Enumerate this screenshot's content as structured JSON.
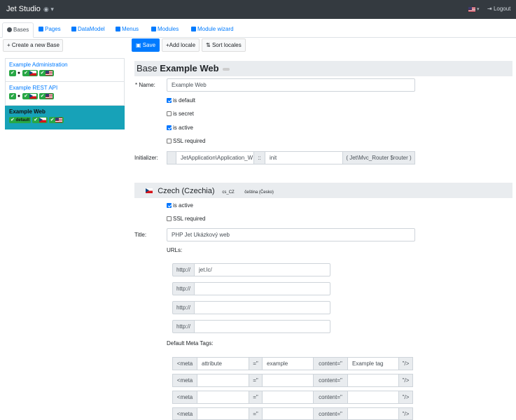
{
  "app": {
    "title": "Jet Studio",
    "logout_label": "Logout"
  },
  "tabs": [
    {
      "label": "Bases"
    },
    {
      "label": "Pages"
    },
    {
      "label": "DataModel"
    },
    {
      "label": "Menus"
    },
    {
      "label": "Modules"
    },
    {
      "label": "Module wizard"
    }
  ],
  "sidebar": {
    "create_label": "Create a new Base",
    "bases": [
      {
        "name": "Example Administration"
      },
      {
        "name": "Example REST API"
      },
      {
        "name": "Example Web",
        "default_label": "default"
      }
    ]
  },
  "toolbar": {
    "save_label": "Save",
    "add_locale_label": "Add locale",
    "sort_locales_label": "Sort locales"
  },
  "base": {
    "heading_prefix": "Base",
    "heading_name": "Example Web",
    "name_label": "* Name:",
    "name_value": "Example Web",
    "is_default_label": "is default",
    "is_secret_label": "is secret",
    "is_active_label": "is active",
    "ssl_label": "SSL required",
    "initializer_label": "Initializer:",
    "initializer_class": "JetApplication\\Application_W",
    "initializer_sep": "::",
    "initializer_method": "init",
    "initializer_signature": "( Jet\\Mvc_Router $router )"
  },
  "locale": {
    "title": "Czech (Czechia)",
    "code": "cs_CZ",
    "native": "čeština (Česko)",
    "is_active_label": "is active",
    "ssl_label": "SSL required",
    "title_label": "Title:",
    "title_value": "PHP Jet Ukázkový web",
    "urls_label": "URLs:",
    "url_prefix": "http://",
    "urls": [
      "jet.lc/",
      "",
      "",
      ""
    ],
    "meta_label": "Default Meta Tags:",
    "meta_open": "<meta",
    "meta_eq": "=\"",
    "meta_content": "content=\"",
    "meta_close": "\"/>",
    "meta_tags": [
      {
        "attribute": "attribute",
        "value": "example",
        "content": "Example tag"
      },
      {
        "attribute": "",
        "value": "",
        "content": ""
      },
      {
        "attribute": "",
        "value": "",
        "content": ""
      },
      {
        "attribute": "",
        "value": "",
        "content": ""
      }
    ]
  }
}
